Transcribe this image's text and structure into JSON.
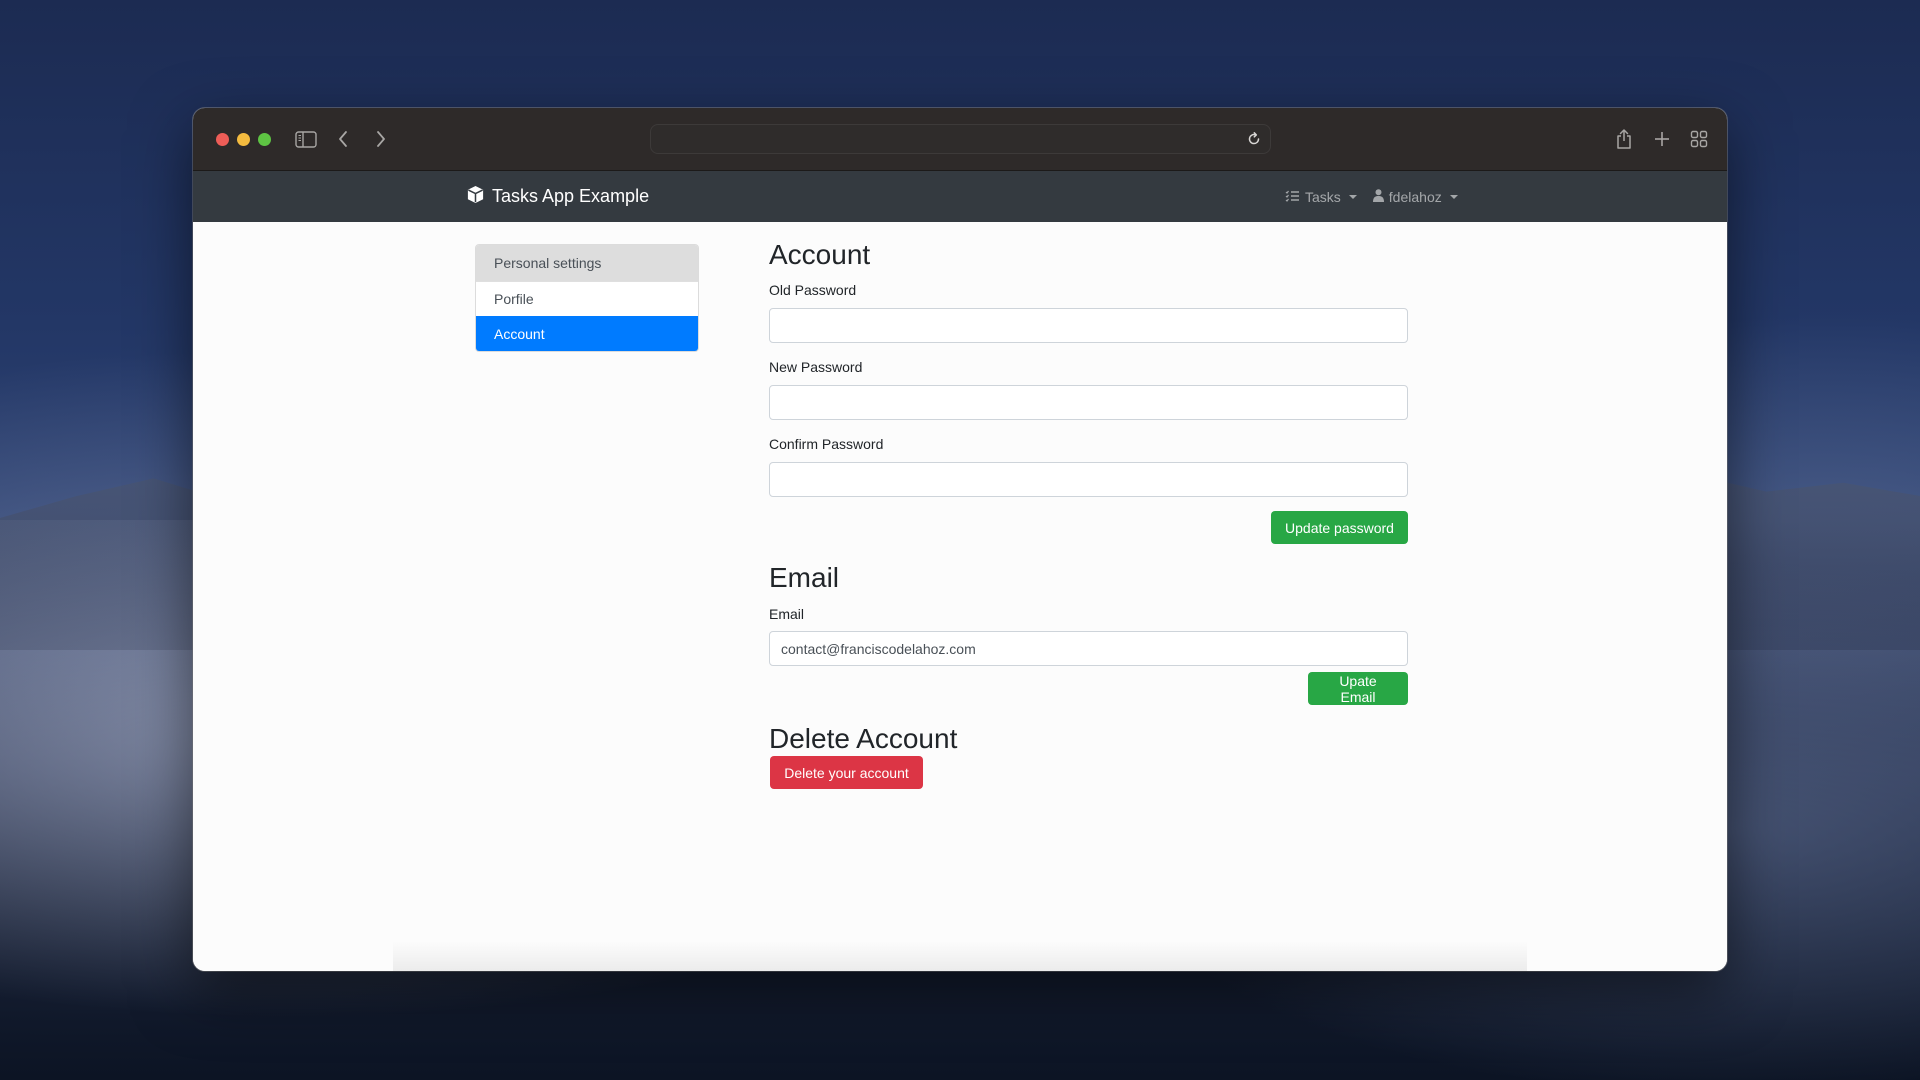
{
  "browser": {
    "url": "",
    "icons": {
      "sidebar_toggle": "sidebar-icon",
      "back": "chevron-left-icon",
      "forward": "chevron-right-icon",
      "reload": "reload-icon",
      "share": "share-icon",
      "new_tab": "plus-icon",
      "tab_overview": "grid-icon"
    }
  },
  "navbar": {
    "brand": "Tasks App Example",
    "brand_icon": "cube-icon",
    "tasks_label": "Tasks",
    "tasks_icon": "list-icon",
    "user_label": "fdelahoz",
    "user_icon": "user-icon"
  },
  "sidebar": {
    "header": "Personal settings",
    "items": [
      {
        "label": "Porfile",
        "active": false
      },
      {
        "label": "Account",
        "active": true
      }
    ]
  },
  "account": {
    "title": "Account",
    "old_password_label": "Old Password",
    "old_password_value": "",
    "new_password_label": "New Password",
    "new_password_value": "",
    "confirm_password_label": "Confirm Password",
    "confirm_password_value": "",
    "update_button": "Update password"
  },
  "email": {
    "title": "Email",
    "email_label": "Email",
    "email_value": "contact@franciscodelahoz.com",
    "update_button": "Upate Email"
  },
  "delete": {
    "title": "Delete Account",
    "button": "Delete your account"
  },
  "colors": {
    "navbar": "#343a40",
    "primary": "#007bff",
    "success": "#28a745",
    "danger": "#dc3545"
  }
}
